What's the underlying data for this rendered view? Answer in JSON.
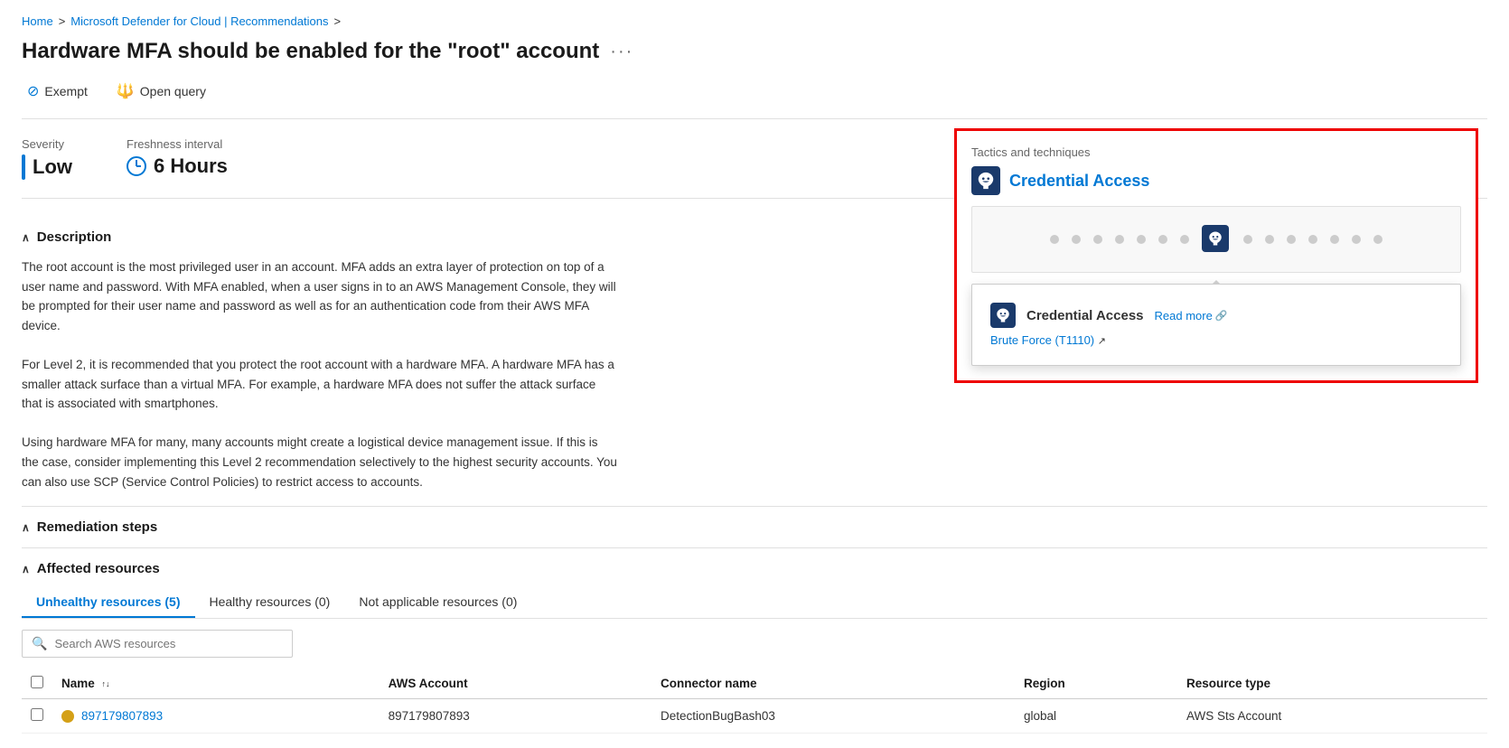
{
  "breadcrumb": {
    "home": "Home",
    "separator1": ">",
    "middle": "Microsoft Defender for Cloud | Recommendations",
    "separator2": ">"
  },
  "pageTitle": "Hardware MFA should be enabled for the \"root\" account",
  "ellipsis": "···",
  "toolbar": {
    "exempt_label": "Exempt",
    "openquery_label": "Open query"
  },
  "severity": {
    "label": "Severity",
    "value": "Low"
  },
  "freshness": {
    "label": "Freshness interval",
    "value": "6 Hours"
  },
  "tactics": {
    "section_label": "Tactics and techniques",
    "title": "Credential Access",
    "credential_access_label": "Credential Access",
    "read_more": "Read more",
    "brute_force_label": "Brute Force",
    "brute_force_code": "(T1110)"
  },
  "description": {
    "label": "Description",
    "text": "The root account is the most privileged user in an account. MFA adds an extra layer of protection on top of a user name and password. With MFA enabled, when a user signs in to an AWS Management Console, they will be prompted for their user name and password as well as for an authentication code from their AWS MFA device. For Level 2, it is recommended that you protect the root account with a hardware MFA. A hardware MFA has a smaller attack surface than a virtual MFA. For example, a hardware MFA does not suffer the attack surface that is associated with smartphones. Using hardware MFA for many, many accounts might create a logistical device management issue. If this is the case, consider implementing this Level 2 recommendation selectively to the highest security accounts. You can also use SCP (Service Control Policies) to restrict access to accounts."
  },
  "remediation": {
    "label": "Remediation steps"
  },
  "affectedResources": {
    "label": "Affected resources",
    "tabs": [
      {
        "id": "unhealthy",
        "label": "Unhealthy resources (5)",
        "active": true
      },
      {
        "id": "healthy",
        "label": "Healthy resources (0)",
        "active": false
      },
      {
        "id": "notapplicable",
        "label": "Not applicable resources (0)",
        "active": false
      }
    ],
    "search_placeholder": "Search AWS resources",
    "table": {
      "columns": [
        {
          "id": "name",
          "label": "Name",
          "sortable": true
        },
        {
          "id": "awsAccount",
          "label": "AWS Account",
          "sortable": false
        },
        {
          "id": "connectorName",
          "label": "Connector name",
          "sortable": false
        },
        {
          "id": "region",
          "label": "Region",
          "sortable": false
        },
        {
          "id": "resourceType",
          "label": "Resource type",
          "sortable": false
        }
      ],
      "rows": [
        {
          "id": "row1",
          "name": "897179807893",
          "awsAccount": "897179807893",
          "connectorName": "DetectionBugBash03",
          "region": "global",
          "resourceType": "AWS Sts Account"
        }
      ]
    }
  }
}
